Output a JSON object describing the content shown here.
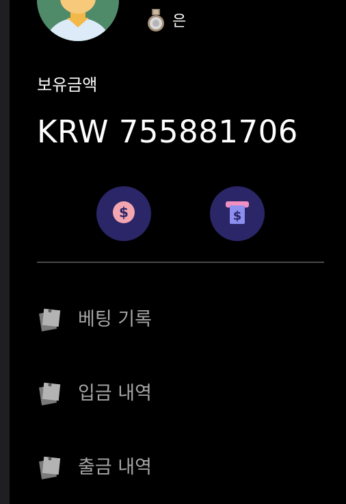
{
  "profile": {
    "rank_label": "은",
    "rank_icon": "silver-medal-icon"
  },
  "balance": {
    "label": "보유금액",
    "value": "KRW 755881706"
  },
  "actions": {
    "deposit_icon": "dollar-coin-icon",
    "withdraw_icon": "atm-cash-icon"
  },
  "menu": {
    "items": [
      {
        "label": "베팅 기록",
        "icon": "notes-icon"
      },
      {
        "label": "입금 내역",
        "icon": "notes-icon"
      },
      {
        "label": "출금 내역",
        "icon": "notes-icon"
      }
    ]
  },
  "colors": {
    "background": "#000000",
    "action_button_bg": "#2a2668",
    "menu_text": "#a6a6a6",
    "divider": "#4a4a4a",
    "avatar_bg": "#4f8a69"
  }
}
